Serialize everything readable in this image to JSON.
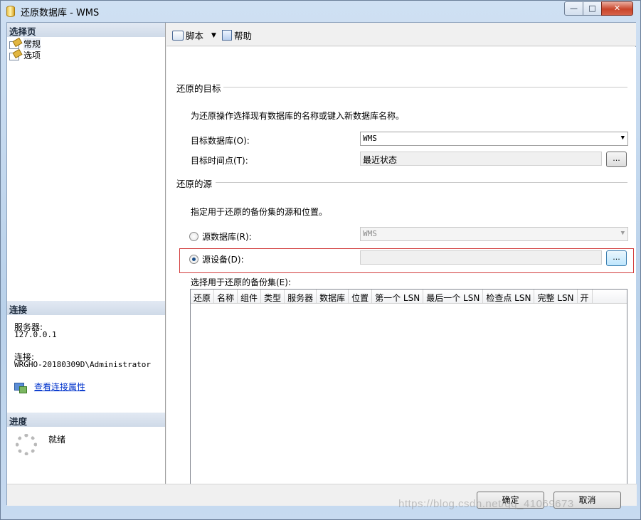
{
  "window": {
    "title": "还原数据库 - WMS",
    "min_glyph": "—",
    "max_glyph": "□",
    "close_glyph": "✕"
  },
  "left": {
    "select_page_header": "选择页",
    "nav_items": [
      {
        "label": "常规",
        "icon": "page-icon"
      },
      {
        "label": "选项",
        "icon": "page-icon"
      }
    ],
    "connection_header": "连接",
    "server_label": "服务器:",
    "server_value": "127.0.0.1",
    "connection_label": "连接:",
    "connection_value": "WRGHO-20180309D\\Administrator",
    "view_props_link": "查看连接属性",
    "progress_header": "进度",
    "progress_status": "就绪"
  },
  "toolbar": {
    "script_label": "脚本",
    "dropdown_glyph": "▼",
    "help_label": "帮助"
  },
  "target": {
    "group_title": "还原的目标",
    "description": "为还原操作选择现有数据库的名称或键入新数据库名称。",
    "target_db_label": "目标数据库(O):",
    "target_db_value": "WMS",
    "target_time_label": "目标时间点(T):",
    "target_time_value": "最近状态",
    "browse_label": "..."
  },
  "source": {
    "group_title": "还原的源",
    "description": "指定用于还原的备份集的源和位置。",
    "source_db_label": "源数据库(R):",
    "source_db_value": "WMS",
    "source_device_label": "源设备(D):",
    "source_device_value": "",
    "browse_label": "...",
    "selected_option": "source_device"
  },
  "backup_sets": {
    "label": "选择用于还原的备份集(E):",
    "columns": [
      "还原",
      "名称",
      "组件",
      "类型",
      "服务器",
      "数据库",
      "位置",
      "第一个 LSN",
      "最后一个 LSN",
      "检查点 LSN",
      "完整 LSN",
      "开"
    ],
    "rows": [],
    "scroll_left_glyph": "◀",
    "scroll_right_glyph": "▶",
    "thumb_grip": "|||"
  },
  "buttons": {
    "ok_label": "确定",
    "cancel_label": "取消"
  },
  "watermark": "https://blog.csdn.net/qq_41069673"
}
